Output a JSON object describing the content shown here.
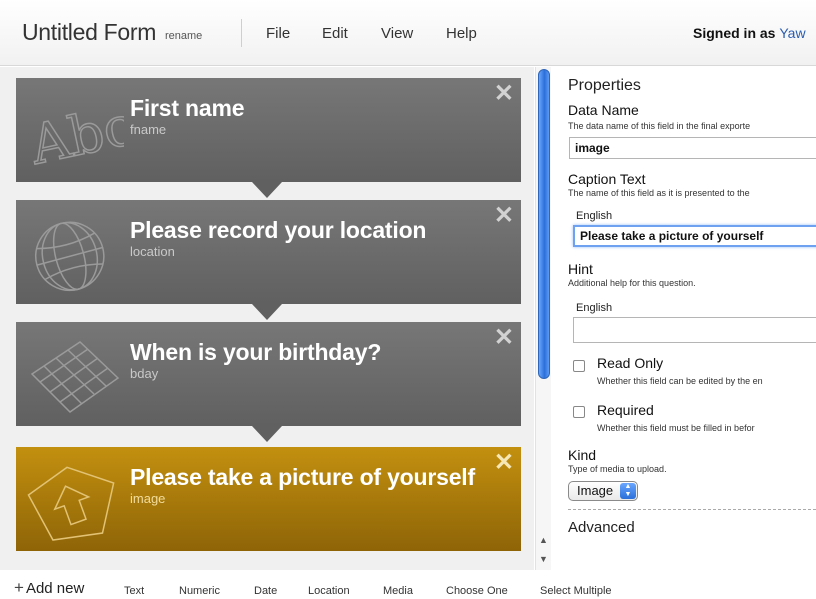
{
  "header": {
    "form_title": "Untitled Form",
    "rename_link": "rename",
    "menu": [
      "File",
      "Edit",
      "View",
      "Help"
    ],
    "signed_in_label": "Signed in as",
    "user": "Yaw"
  },
  "fields": [
    {
      "title": "First name",
      "name": "fname",
      "icon": "text-abc-icon",
      "selected": false
    },
    {
      "title": "Please record your location",
      "name": "location",
      "icon": "globe-icon",
      "selected": false
    },
    {
      "title": "When is your birthday?",
      "name": "bday",
      "icon": "calendar-icon",
      "selected": false
    },
    {
      "title": "Please take a picture of yourself",
      "name": "image",
      "icon": "media-upload-icon",
      "selected": true
    }
  ],
  "close_glyph": "✕",
  "properties": {
    "heading": "Properties",
    "data_name": {
      "label": "Data Name",
      "description": "The data name of this field in the final exporte",
      "value": "image"
    },
    "caption": {
      "label": "Caption Text",
      "description": "The name of this field as it is presented to the",
      "language": "English",
      "value": "Please take a picture of yourself"
    },
    "hint": {
      "label": "Hint",
      "description": "Additional help for this question.",
      "language": "English",
      "value": ""
    },
    "read_only": {
      "label": "Read Only",
      "description": "Whether this field can be edited by the en",
      "checked": false
    },
    "required": {
      "label": "Required",
      "description": "Whether this field must be filled in befor",
      "checked": false
    },
    "kind": {
      "label": "Kind",
      "description": "Type of media to upload.",
      "selected": "Image"
    },
    "advanced": "Advanced"
  },
  "bottom": {
    "add_new": "Add new",
    "types": [
      "Text",
      "Numeric",
      "Date",
      "Location",
      "Media",
      "Choose One",
      "Select Multiple"
    ]
  },
  "colors": {
    "card_gray": "#666666",
    "card_selected": "#a8790b",
    "scrollbar_blue": "#2a6fd9",
    "link_blue": "#2a5db0"
  }
}
